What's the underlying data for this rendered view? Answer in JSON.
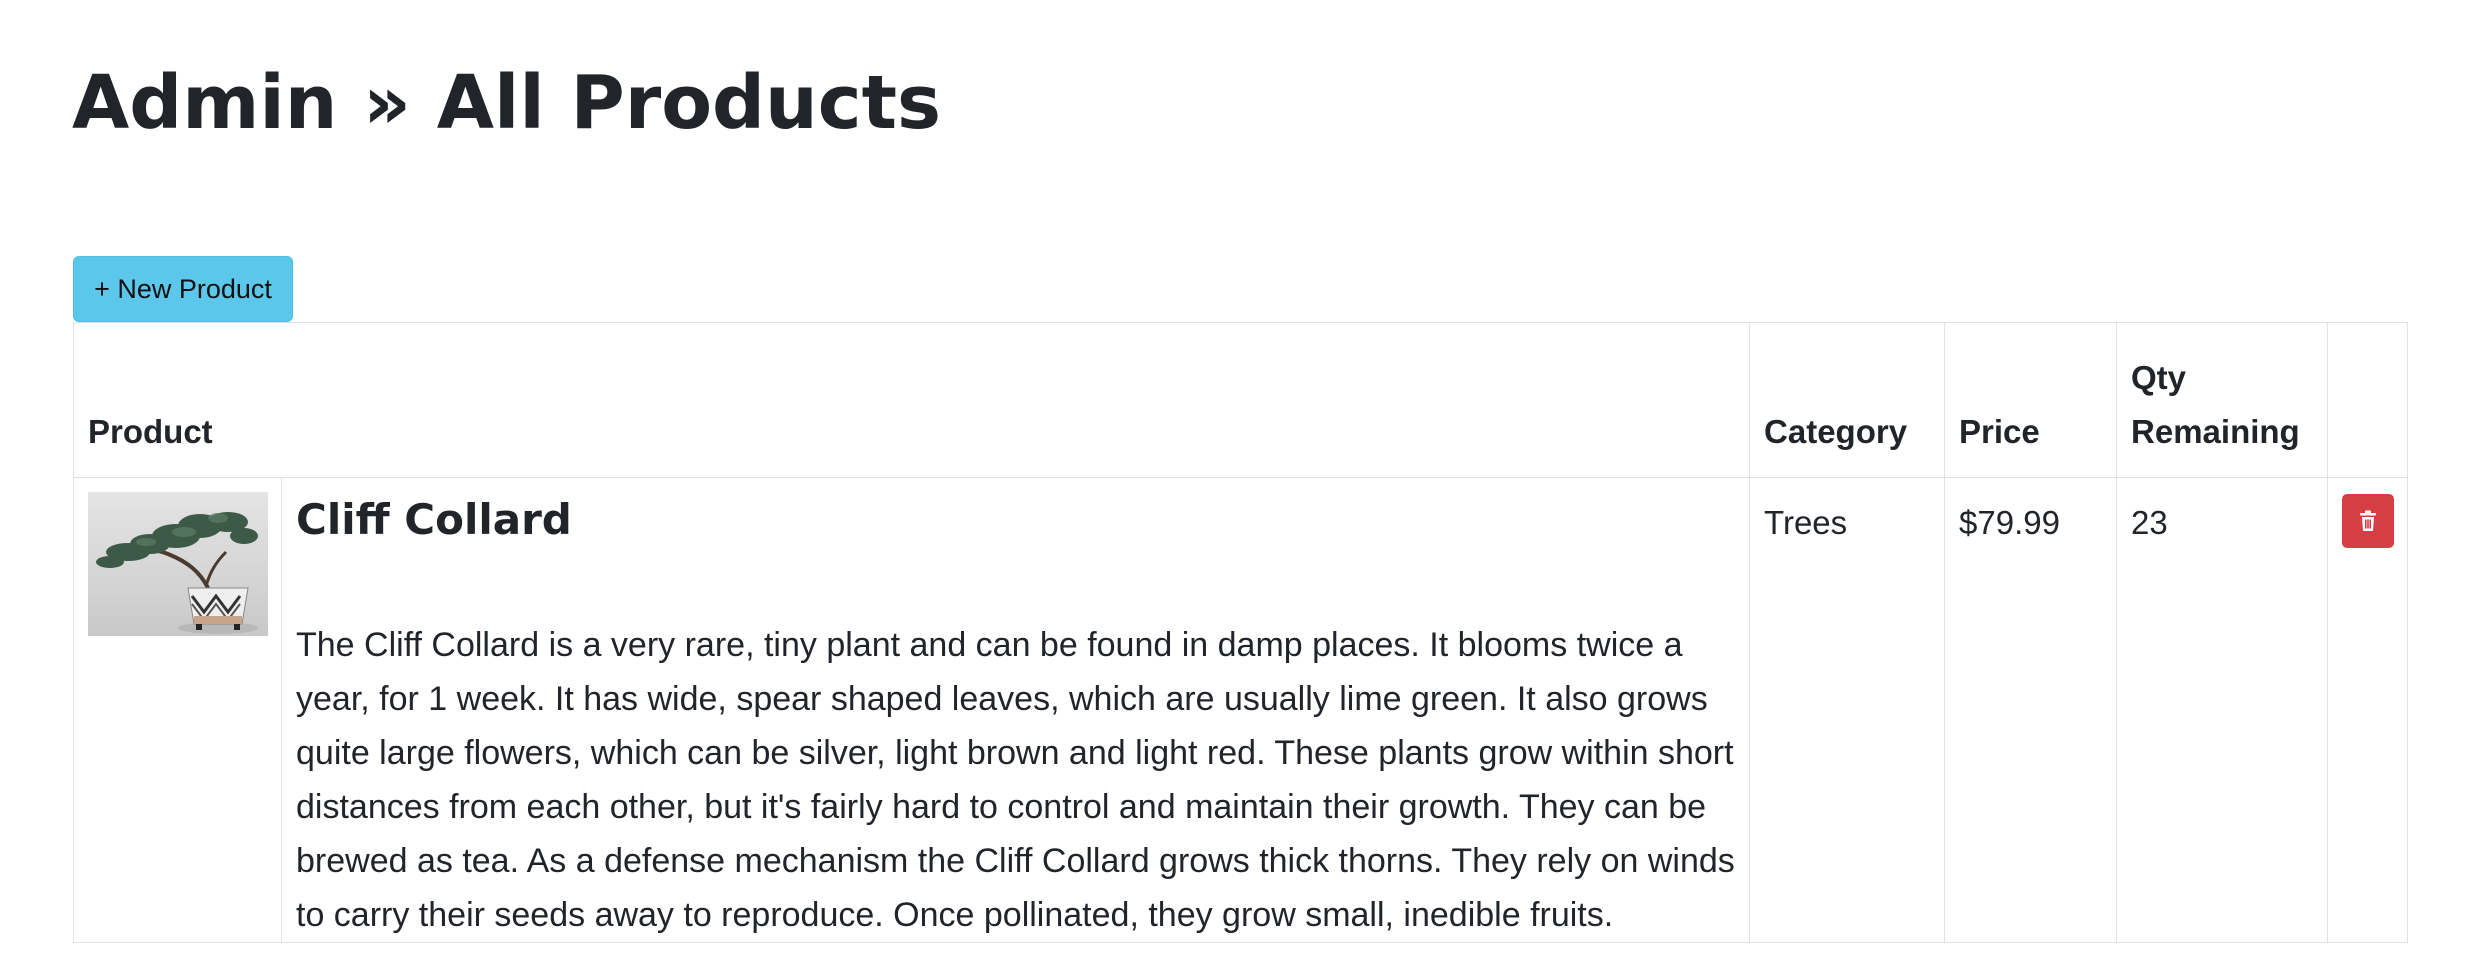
{
  "header": {
    "title": "Admin » All Products"
  },
  "toolbar": {
    "new_product_label": "+ New Product"
  },
  "table": {
    "columns": {
      "product": "Product",
      "category": "Category",
      "price": "Price",
      "qty_line1": "Qty",
      "qty_line2": "Remaining"
    },
    "rows": [
      {
        "name": "Cliff Collard",
        "description": "The Cliff Collard is a very rare, tiny plant and can be found in damp places. It blooms twice a year, for 1 week. It has wide, spear shaped leaves, which are usually lime green. It also grows quite large flowers, which can be silver, light brown and light red. These plants grow within short distances from each other, but it's fairly hard to control and maintain their growth. They can be brewed as tea. As a defense mechanism the Cliff Collard grows thick thorns. They rely on winds to carry their seeds away to reproduce. Once pollinated, they grow small, inedible fruits.",
        "category": "Trees",
        "price": "$79.99",
        "qty": "23",
        "image_icon": "bonsai-tree-image",
        "action_icon": "trash-icon"
      }
    ]
  },
  "colors": {
    "new_button_bg": "#5bc8eb",
    "delete_button_bg": "#d43f45",
    "border": "#dee2e6",
    "text": "#212529"
  }
}
